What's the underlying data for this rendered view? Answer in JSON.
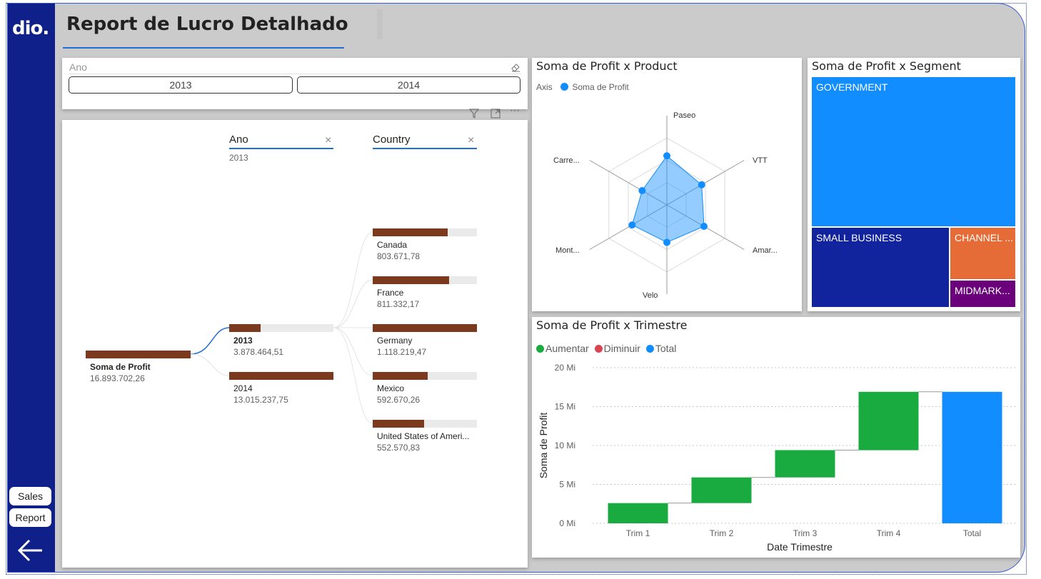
{
  "app": {
    "logo_text": "dio.",
    "title": "Report de Lucro Detalhado"
  },
  "nav": {
    "sales_label": "Sales",
    "report_label": "Report",
    "back_icon": "arrow-left-icon"
  },
  "slicer": {
    "label": "Ano",
    "options": [
      "2013",
      "2014"
    ]
  },
  "decomposition": {
    "level1_label": "Ano",
    "level1_selected": "2013",
    "level2_label": "Country",
    "root": {
      "label": "Soma de Profit",
      "value": "16.893.702,26"
    },
    "years": [
      {
        "label": "2013",
        "value": "3.878.464,51",
        "fill": 0.3
      },
      {
        "label": "2014",
        "value": "13.015.237,75",
        "fill": 1.0
      }
    ],
    "countries": [
      {
        "label": "Canada",
        "value": "803.671,78",
        "fill": 0.72
      },
      {
        "label": "France",
        "value": "811.332,17",
        "fill": 0.73
      },
      {
        "label": "Germany",
        "value": "1.118.219,47",
        "fill": 1.0
      },
      {
        "label": "Mexico",
        "value": "592.670,26",
        "fill": 0.53
      },
      {
        "label": "United States of Ameri...",
        "value": "552.570,83",
        "fill": 0.49
      }
    ]
  },
  "radar": {
    "title": "Soma de Profit x Product",
    "legend_axis": "Axis",
    "legend_series": "Soma de Profit",
    "axes": [
      "Paseo",
      "VTT",
      "Amar...",
      "Velo",
      "Mont...",
      "Carre..."
    ],
    "relative_values": [
      0.55,
      0.45,
      0.48,
      0.42,
      0.45,
      0.32
    ],
    "color": "#118dff"
  },
  "treemap": {
    "title": "Soma de Profit x Segment",
    "cells": [
      {
        "label": "GOVERNMENT",
        "color": "#118dff"
      },
      {
        "label": "SMALL BUSINESS",
        "color": "#12239e"
      },
      {
        "label": "CHANNEL ...",
        "color": "#e66c37"
      },
      {
        "label": "MIDMARK...",
        "color": "#6b007b"
      }
    ]
  },
  "waterfall": {
    "title": "Soma de Profit x Trimestre",
    "legend": [
      {
        "label": "Aumentar",
        "color": "#1aab40"
      },
      {
        "label": "Diminuir",
        "color": "#d64550"
      },
      {
        "label": "Total",
        "color": "#118dff"
      }
    ],
    "ytick_labels": [
      "0 Mi",
      "5 Mi",
      "10 Mi",
      "15 Mi",
      "20 Mi"
    ]
  },
  "chart_data": {
    "type": "bar",
    "subtype": "waterfall",
    "title": "Soma de Profit x Trimestre",
    "xlabel": "Date Trimestre",
    "ylabel": "Soma de Profit",
    "categories": [
      "Trim 1",
      "Trim 2",
      "Trim 3",
      "Trim 4",
      "Total"
    ],
    "series": [
      {
        "name": "Aumentar",
        "values": [
          2.6,
          3.3,
          3.5,
          7.5,
          null
        ]
      },
      {
        "name": "Total",
        "values": [
          null,
          null,
          null,
          null,
          16.9
        ]
      }
    ],
    "ylim": [
      0,
      20
    ],
    "yticks": [
      0,
      5,
      10,
      15,
      20
    ],
    "grid": true,
    "legend": "top-left"
  }
}
